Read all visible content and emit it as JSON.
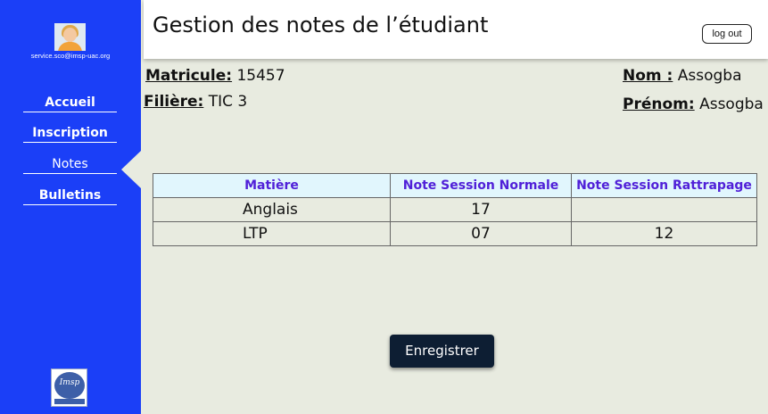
{
  "sidebar": {
    "email": "service.sco@imsp-uac.org",
    "items": [
      {
        "label": "Accueil"
      },
      {
        "label": "Inscription"
      },
      {
        "label": "Notes"
      },
      {
        "label": "Bulletins"
      }
    ],
    "active": "Notes",
    "logo_text": "Imsp"
  },
  "header": {
    "title": "Gestion des notes de l’étudiant",
    "logout_label": "log out"
  },
  "student": {
    "matricule_label": "Matricule:",
    "matricule": "15457",
    "filiere_label": "Filière:",
    "filiere": "TIC 3",
    "nom_label": "Nom :",
    "nom": "Assogba",
    "prenom_label": "Prénom:",
    "prenom": "Assogba"
  },
  "table": {
    "headers": [
      "Matière",
      "Note Session Normale",
      "Note Session Rattrapage"
    ],
    "rows": [
      [
        "Anglais",
        "17",
        ""
      ],
      [
        "LTP",
        "07",
        "12"
      ]
    ]
  },
  "actions": {
    "save_label": "Enregistrer"
  },
  "colors": {
    "sidebar": "#1b3ff7",
    "header_text": "#5020d8",
    "button": "#0d1e33"
  }
}
